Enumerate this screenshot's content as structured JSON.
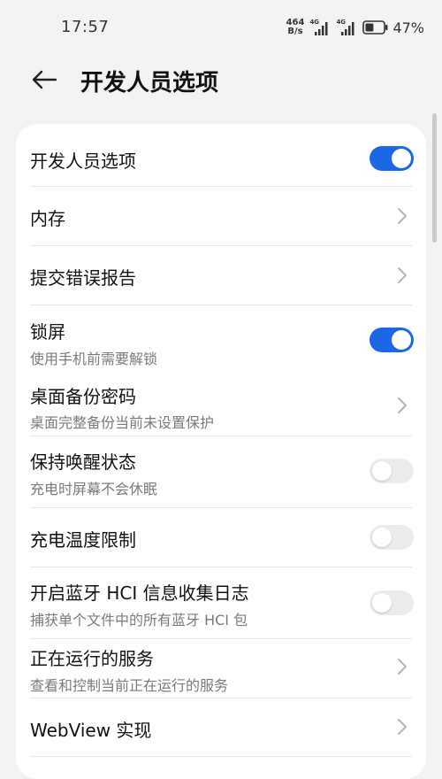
{
  "status_bar": {
    "time": "17:57",
    "net_speed_value": "464",
    "net_speed_unit": "B/s",
    "sim1_tag": "4G",
    "sim2_tag": "4G",
    "battery_percent": "47%",
    "battery_level": 0.47
  },
  "header": {
    "back_icon": "arrow-left-icon",
    "title": "开发人员选项"
  },
  "settings": {
    "developer_options": {
      "title": "开发人员选项",
      "toggle_on": true
    },
    "memory": {
      "title": "内存"
    },
    "bug_report": {
      "title": "提交错误报告"
    },
    "screen_lock": {
      "title": "锁屏",
      "subtitle": "使用手机前需要解锁",
      "toggle_on": true
    },
    "desktop_backup_password": {
      "title": "桌面备份密码",
      "subtitle": "桌面完整备份当前未设置保护"
    },
    "stay_awake": {
      "title": "保持唤醒状态",
      "subtitle": "充电时屏幕不会休眠",
      "toggle_on": false
    },
    "charging_temp_limit": {
      "title": "充电温度限制",
      "toggle_on": false
    },
    "bluetooth_hci_log": {
      "title": "开启蓝牙 HCI 信息收集日志",
      "subtitle": "捕获单个文件中的所有蓝牙 HCI 包",
      "toggle_on": false
    },
    "running_services": {
      "title": "正在运行的服务",
      "subtitle": "查看和控制当前正在运行的服务"
    },
    "webview_impl": {
      "title": "WebView 实现"
    }
  },
  "colors": {
    "accent": "#1a68e6",
    "background": "#f1f3f5",
    "card": "#ffffff",
    "subtitle": "#7a7a7a"
  }
}
